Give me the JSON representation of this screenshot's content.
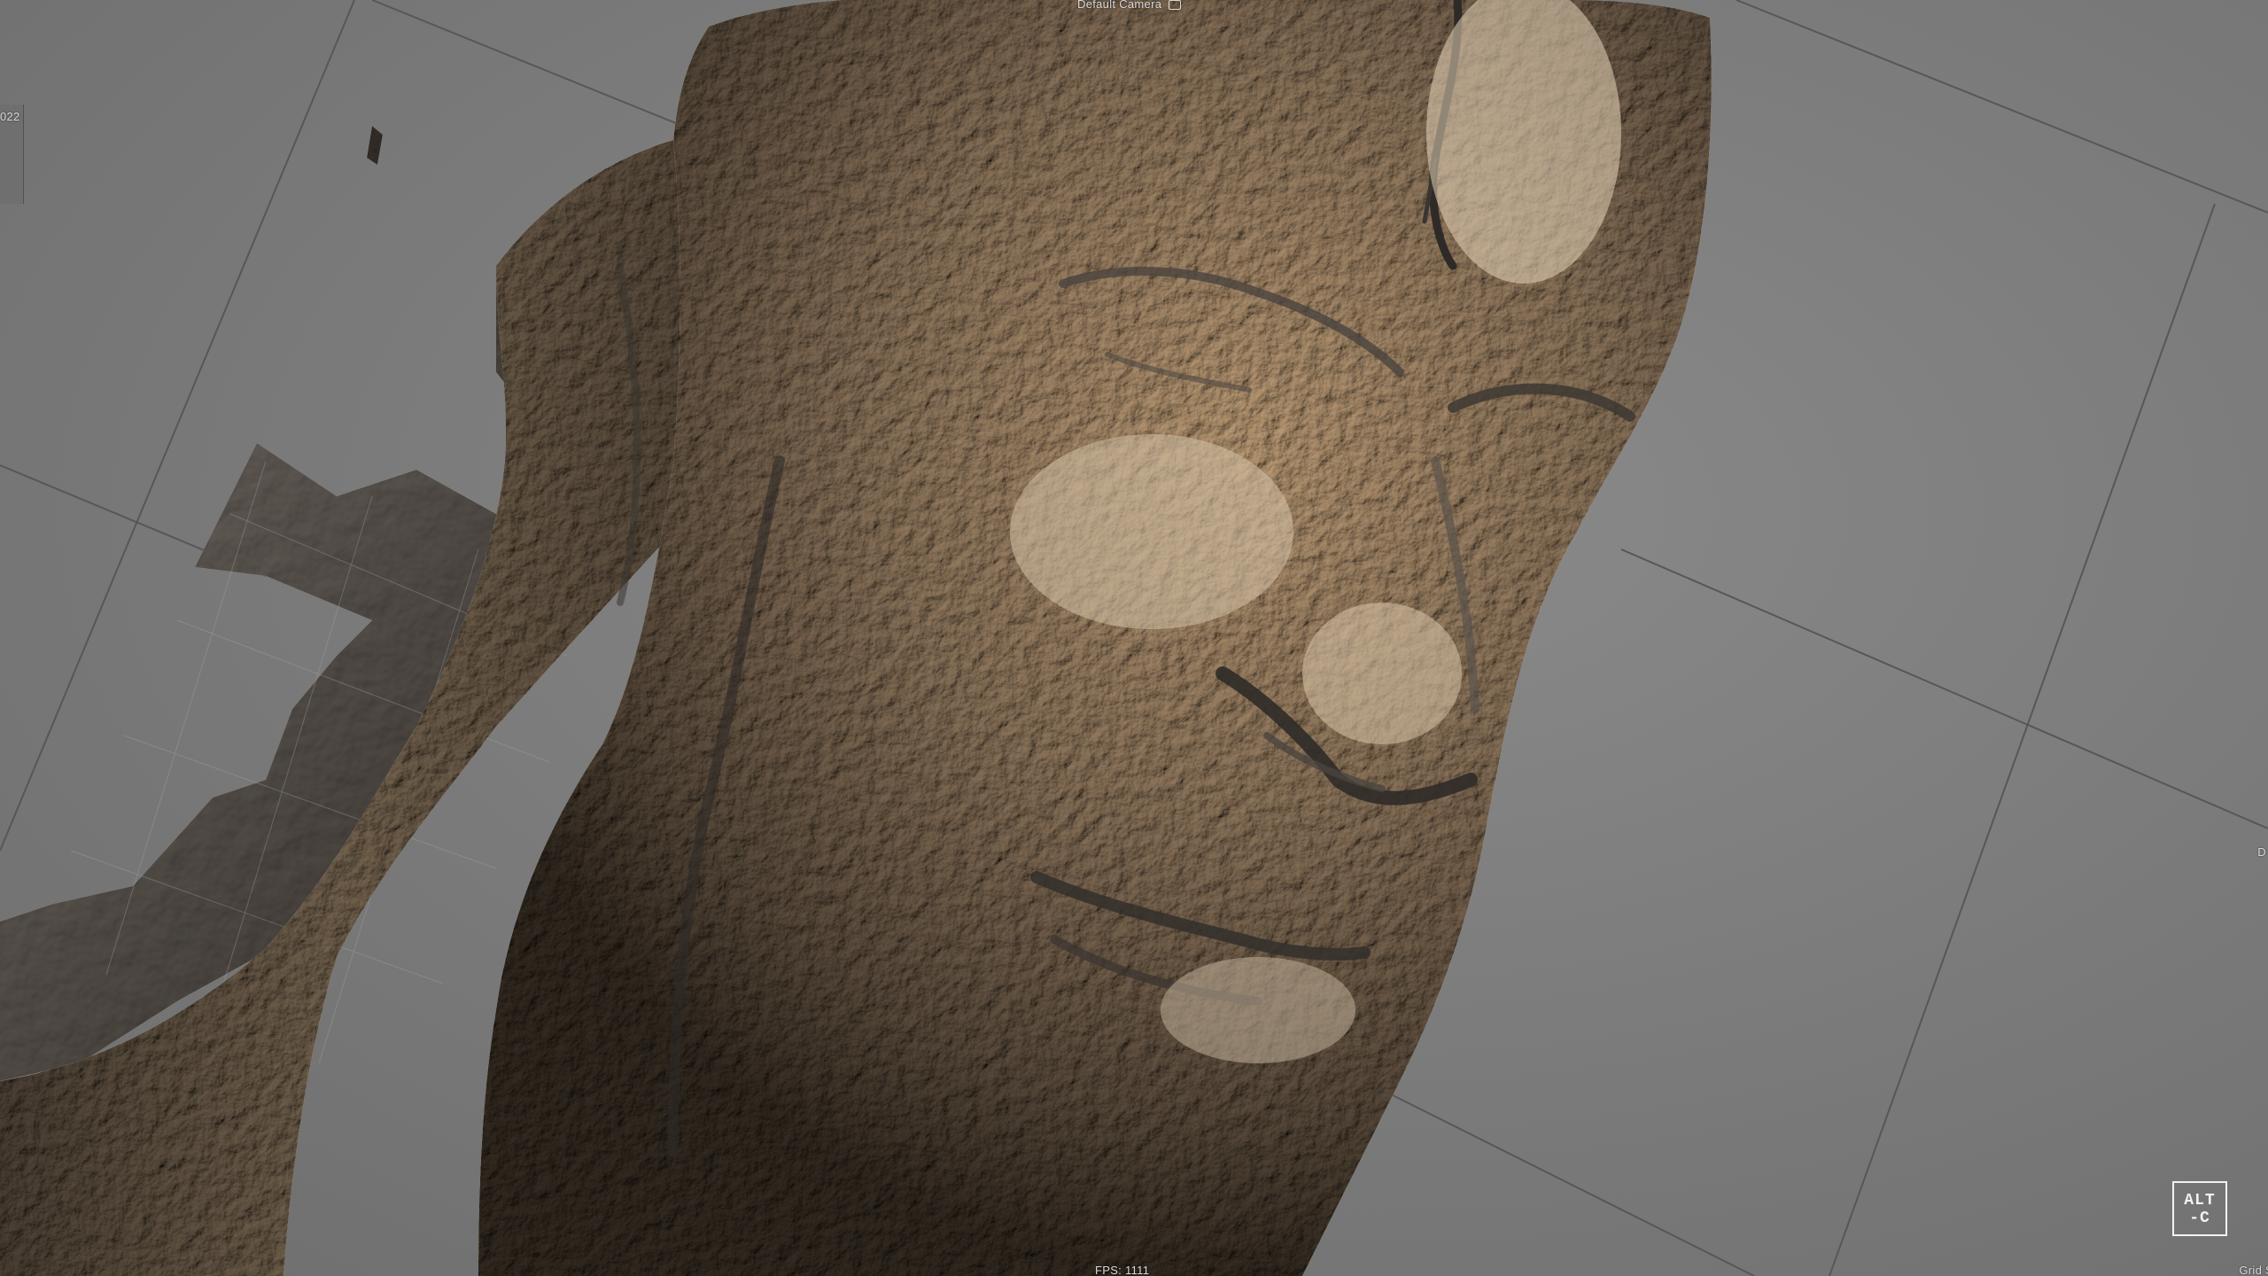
{
  "viewport": {
    "camera_name": "Default Camera",
    "camera_icon": "camera-lock-icon",
    "frame_readout": "022",
    "fps_readout": "FPS: 1111",
    "right_marker": "D",
    "grid_size_readout": "Grid S"
  },
  "logo": {
    "line1": "ALT",
    "line2": "-C"
  },
  "colors": {
    "background": "#7d7d7d",
    "grid_line": "#5a5a5a",
    "mesh_light": "#c8b39a",
    "mesh_mid": "#8a7f74",
    "mesh_dark": "#3e3a37",
    "hud_text": "#d9d9d9"
  }
}
